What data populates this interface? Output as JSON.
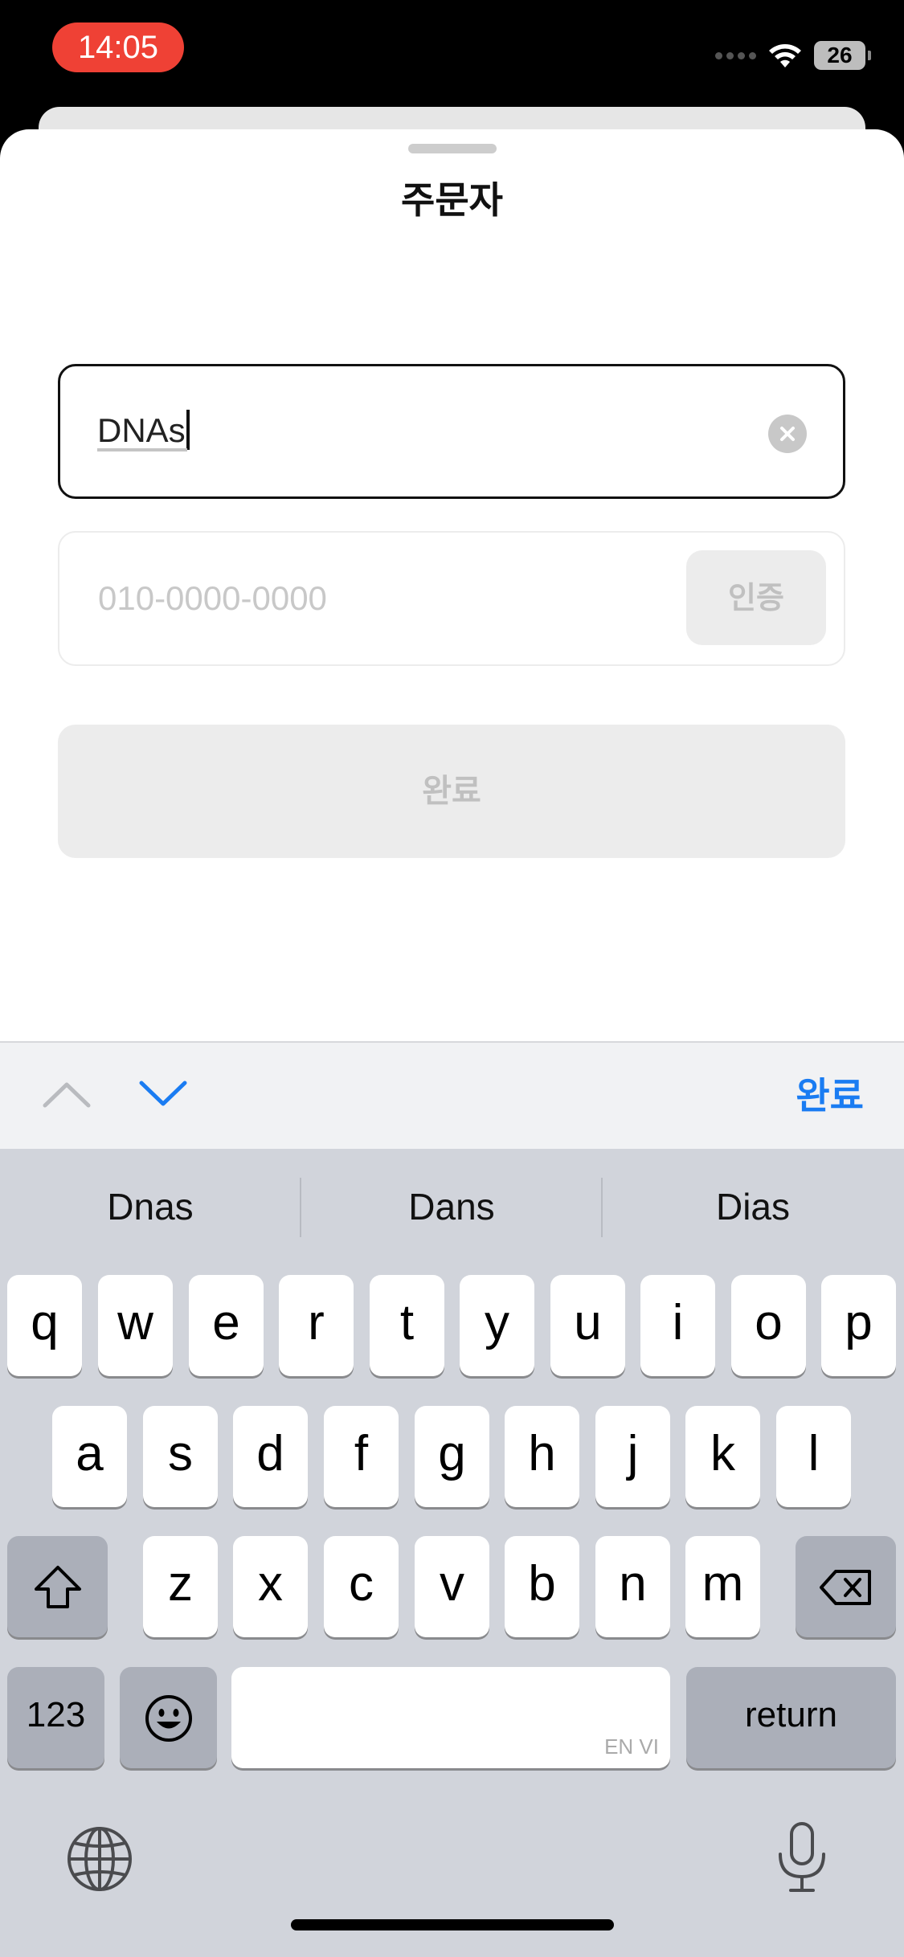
{
  "status_bar": {
    "time": "14:05",
    "battery": "26"
  },
  "sheet": {
    "title": "주문자"
  },
  "form": {
    "name_value": "DNAs",
    "phone_placeholder": "010-0000-0000",
    "verify_label": "인증",
    "complete_label": "완료"
  },
  "accessory_bar": {
    "done_label": "완료"
  },
  "keyboard": {
    "suggestions": [
      "Dnas",
      "Dans",
      "Dias"
    ],
    "row1": [
      "q",
      "w",
      "e",
      "r",
      "t",
      "y",
      "u",
      "i",
      "o",
      "p"
    ],
    "row2": [
      "a",
      "s",
      "d",
      "f",
      "g",
      "h",
      "j",
      "k",
      "l"
    ],
    "row3": [
      "z",
      "x",
      "c",
      "v",
      "b",
      "n",
      "m"
    ],
    "numbers_label": "123",
    "return_label": "return",
    "space_languages": "EN VI"
  },
  "colors": {
    "accent": "#1a7cf2",
    "time_pill": "#ef4135"
  }
}
